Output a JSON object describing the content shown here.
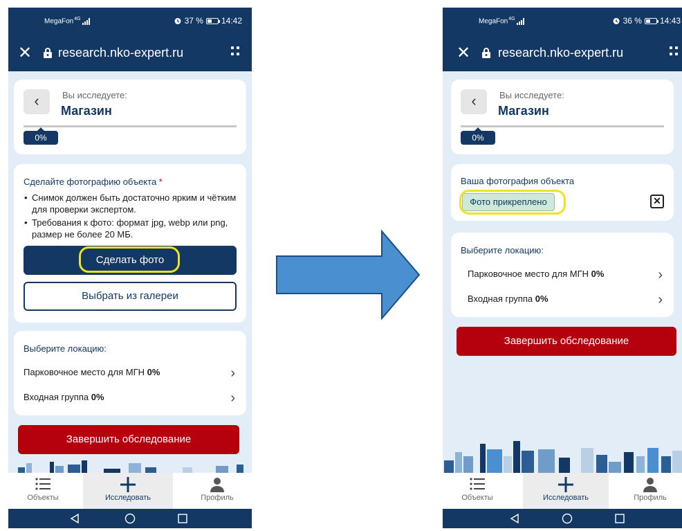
{
  "status": {
    "left": {
      "carrier": "MegaFon",
      "network": "4G",
      "battery": "37 %",
      "time": "14:42"
    },
    "right": {
      "carrier": "MegaFon",
      "network": "4G",
      "battery": "36 %",
      "time": "14:43"
    }
  },
  "browser": {
    "url": "research.nko-expert.ru"
  },
  "header": {
    "examining_label": "Вы исследуете:",
    "object_name": "Магазин",
    "progress_label": "0%"
  },
  "photo_step": {
    "title": "Сделайте фотографию объекта",
    "required_mark": "*",
    "rules": [
      "Снимок должен быть достаточно ярким и чётким для проверки экспертом.",
      "Требования к фото: формат jpg, webp или png, размер не более 20 МБ."
    ],
    "take_photo_label": "Сделать фото",
    "gallery_label": "Выбрать из галереи"
  },
  "photo_done": {
    "title": "Ваша фотография объекта",
    "attached_label": "Фото прикреплено",
    "remove_icon": "close-square-icon"
  },
  "locations": {
    "title": "Выберите локацию:",
    "items": [
      {
        "name": "Парковочное место для МГН",
        "percent": "0%"
      },
      {
        "name": "Входная группа",
        "percent": "0%"
      }
    ]
  },
  "finish_label": "Завершить обследование",
  "tabs": [
    {
      "label": "Объекты",
      "icon": "list-icon"
    },
    {
      "label": "Исследовать",
      "icon": "plus-icon"
    },
    {
      "label": "Профиль",
      "icon": "user-icon"
    }
  ],
  "colors": {
    "brand_navy": "#123863",
    "danger_red": "#b5000d",
    "highlight_yellow": "#f2e21f",
    "arrow_blue": "#4a8fd0",
    "attached_green": "#cfe9d8"
  }
}
